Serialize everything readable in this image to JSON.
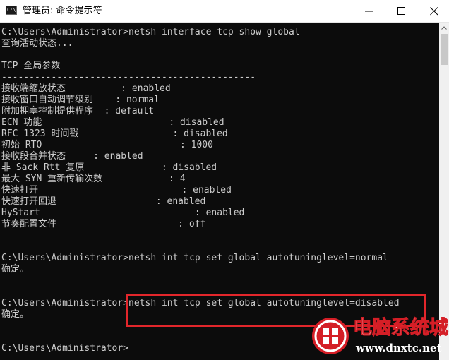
{
  "window": {
    "title": "管理员: 命令提示符",
    "icon_label": "C:\\",
    "buttons": [
      "minimize-icon",
      "maximize-icon",
      "close-icon"
    ]
  },
  "console": {
    "lines": [
      "C:\\Users\\Administrator>netsh interface tcp show global",
      "查询活动状态...",
      "",
      "TCP 全局参数",
      "----------------------------------------------",
      "接收端缩放状态          : enabled",
      "接收窗口自动调节级别    : normal",
      "附加拥塞控制提供程序  : default",
      "ECN 功能                       : disabled",
      "RFC 1323 时间戳                 : disabled",
      "初始 RTO                         : 1000",
      "接收段合并状态     : enabled",
      "非 Sack Rtt 复原              : disabled",
      "最大 SYN 重新传输次数            : 4",
      "快速打开                          : enabled",
      "快速打开回退                  : enabled",
      "HyStart                            : enabled",
      "节奏配置文件                      : off",
      "",
      "",
      "C:\\Users\\Administrator>netsh int tcp set global autotuninglevel=normal",
      "确定。",
      "",
      "",
      "C:\\Users\\Administrator>netsh int tcp set global autotuninglevel=disabled",
      "确定。",
      "",
      "",
      "C:\\Users\\Administrator>"
    ]
  },
  "watermark": {
    "title": "电脑系统城",
    "url": "www.dnxtc.net"
  },
  "colors": {
    "console_bg": "#0c0c0c",
    "console_text": "#cccccc",
    "highlight_border": "#e3262b",
    "watermark_red": "#d41e26"
  }
}
